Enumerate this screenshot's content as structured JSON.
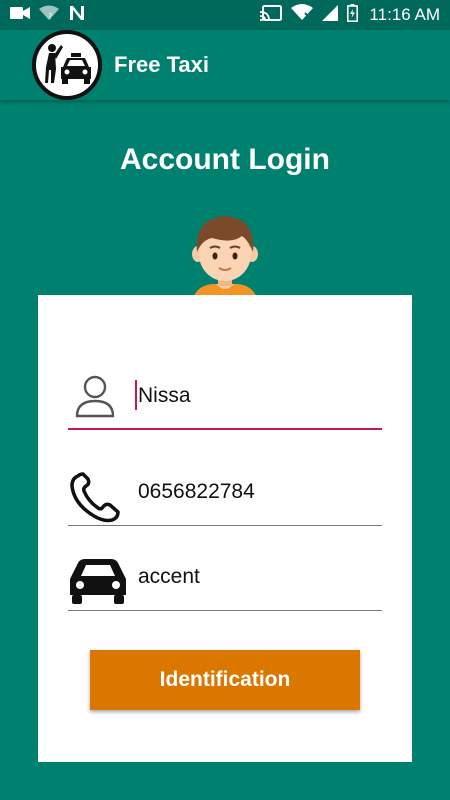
{
  "status_bar": {
    "time": "11:16 AM"
  },
  "app_bar": {
    "title": "Free Taxi",
    "logo_icon": "taxi-logo-icon"
  },
  "page": {
    "title": "Account Login"
  },
  "form": {
    "name": {
      "value": "Nissa",
      "icon": "user-icon"
    },
    "phone": {
      "value": "0656822784",
      "icon": "phone-icon"
    },
    "car": {
      "value": "accent",
      "icon": "car-icon"
    },
    "submit_label": "Identification"
  },
  "colors": {
    "background": "#00806f",
    "status_bar": "#00695c",
    "accent": "#c2185b",
    "button": "#db7600"
  }
}
